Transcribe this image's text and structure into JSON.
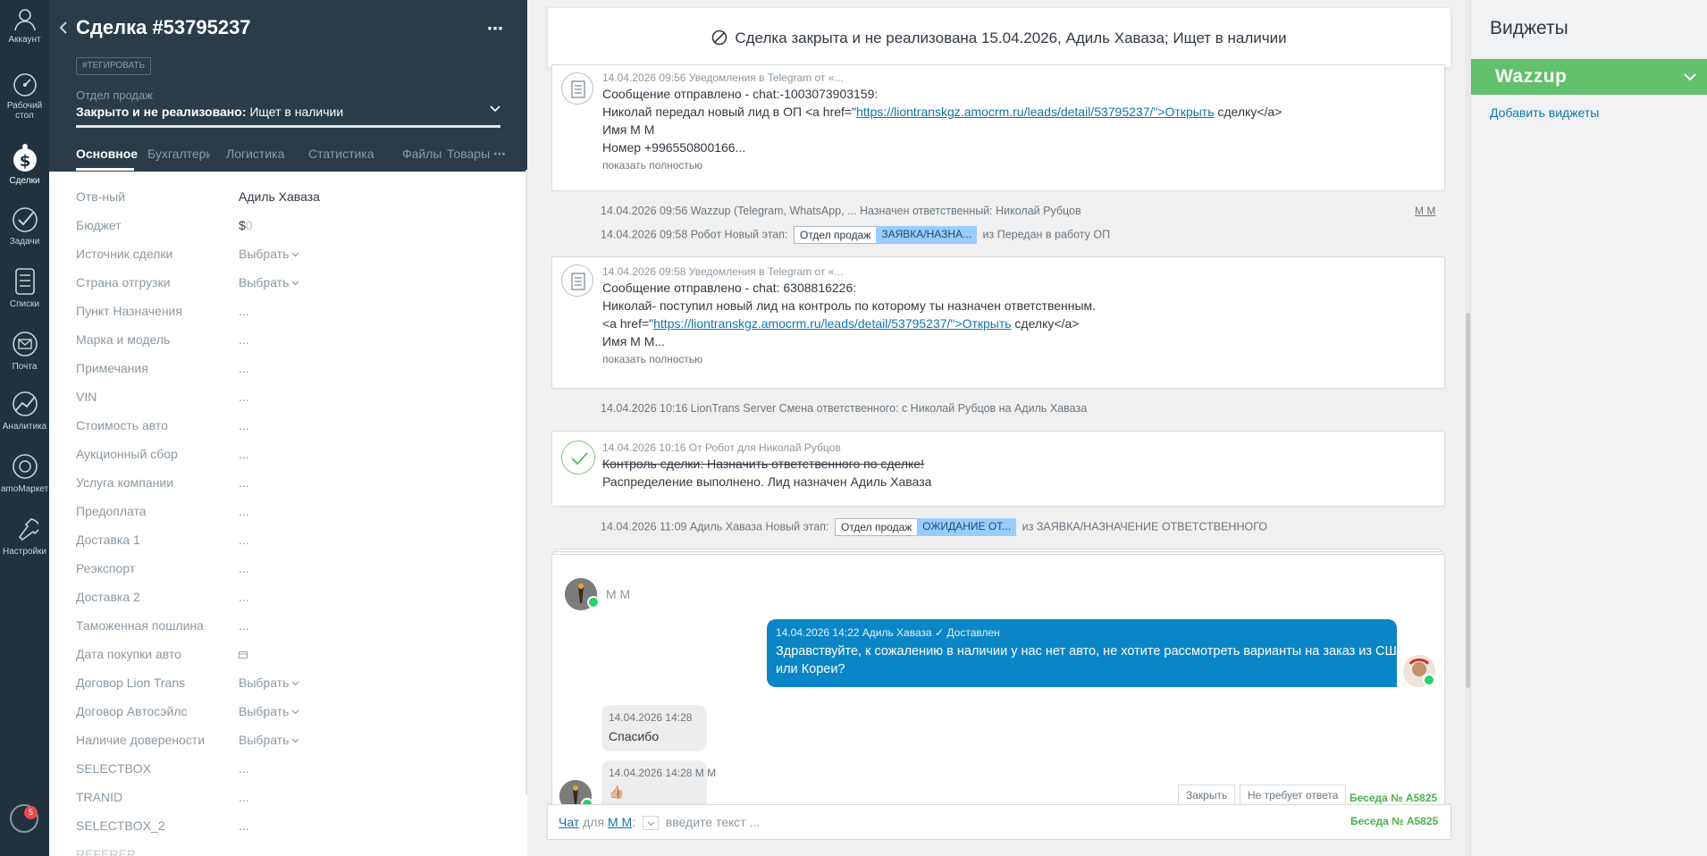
{
  "nav": {
    "items": [
      {
        "label": "Аккаунт",
        "icon": "account-icon"
      },
      {
        "label": "Рабочий стол",
        "icon": "dashboard-icon"
      },
      {
        "label": "Сделки",
        "icon": "deals-icon"
      },
      {
        "label": "Задачи",
        "icon": "tasks-icon"
      },
      {
        "label": "Списки",
        "icon": "lists-icon"
      },
      {
        "label": "Почта",
        "icon": "mail-icon"
      },
      {
        "label": "Аналитика",
        "icon": "analytics-icon"
      },
      {
        "label": "amoМаркет",
        "icon": "market-icon"
      },
      {
        "label": "Настройки",
        "icon": "settings-icon"
      }
    ],
    "notifications_count": "5"
  },
  "card": {
    "title": "Сделка #53795237",
    "tag_button": "#ТЕГИРОВАТЬ",
    "pipeline": "Отдел продаж",
    "status_bold": "Закрыто и не реализовано:",
    "status_rest": " Ищет в наличии",
    "tabs": [
      "Основное",
      "Бухгалтерия",
      "Логистика",
      "Статистика",
      "Файлы",
      "Товары"
    ],
    "fields": [
      {
        "label": "Отв-ный",
        "value": "Адиль Хаваза",
        "kind": "text"
      },
      {
        "label": "Бюджет",
        "value": "$",
        "zero": "0",
        "kind": "budget"
      },
      {
        "label": "Источник сделки",
        "value": "Выбрать",
        "kind": "select"
      },
      {
        "label": "Страна отгрузки",
        "value": "Выбрать",
        "kind": "select"
      },
      {
        "label": "Пункт Назначения",
        "value": "...",
        "kind": "dots"
      },
      {
        "label": "Марка и модель",
        "value": "...",
        "kind": "dots"
      },
      {
        "label": "Примечания",
        "value": "...",
        "kind": "dots"
      },
      {
        "label": "VIN",
        "value": "...",
        "kind": "dots"
      },
      {
        "label": "Стоимость авто",
        "value": "...",
        "kind": "dots"
      },
      {
        "label": "Аукционный сбор",
        "value": "...",
        "kind": "dots"
      },
      {
        "label": "Услуга компании",
        "value": "...",
        "kind": "dots"
      },
      {
        "label": "Предоплата",
        "value": "...",
        "kind": "dots"
      },
      {
        "label": "Доставка 1",
        "value": "...",
        "kind": "dots"
      },
      {
        "label": "Реэкспорт",
        "value": "...",
        "kind": "dots"
      },
      {
        "label": "Доставка 2",
        "value": "...",
        "kind": "dots"
      },
      {
        "label": "Таможенная пошлина",
        "value": "...",
        "kind": "dots"
      },
      {
        "label": "Дата покупки авто",
        "value": "",
        "kind": "date"
      },
      {
        "label": "Договор Lion Trans",
        "value": "Выбрать",
        "kind": "select"
      },
      {
        "label": "Договор Автосэйлс",
        "value": "Выбрать",
        "kind": "select"
      },
      {
        "label": "Наличие довереноcти",
        "value": "Выбрать",
        "kind": "select"
      },
      {
        "label": "SELECTBOX",
        "value": "...",
        "kind": "dots"
      },
      {
        "label": "TRANID",
        "value": "...",
        "kind": "dots"
      },
      {
        "label": "SELECTBOX_2",
        "value": "...",
        "kind": "dots"
      },
      {
        "label": "REFERER",
        "value": "",
        "kind": "text"
      }
    ]
  },
  "feed": {
    "banner": "Сделка закрыта и не реализована 15.04.2026, Адиль Хаваза; Ищет в наличии",
    "note1": {
      "meta": "14.04.2026 09:56 Уведомления в Telegram от «...",
      "line1": "Сообщение отправлено - chat:-1003073903159:",
      "line2_pre": "Николай передал новый лид в ОП <a href=\"",
      "line2_link": "https://liontranskgz.amocrm.ru/leads/detail/53795237/\">Открыть",
      "line2_post": " сделку</a>",
      "line3": "Имя М М",
      "line4": "Номер +996550800166...",
      "more": "показать полностью"
    },
    "event1": "14.04.2026 09:56 Wazzup (Telegram, WhatsApp, ... Назначен ответственный: Николай Рубцов",
    "event1_user": "М М",
    "event2_pre": "14.04.2026 09:58 Робот Новый этап:",
    "event2_chip1": "Отдел продаж",
    "event2_chip2": "ЗАЯВКА/НАЗНА...",
    "event2_post": "из Передан в работу ОП",
    "note2": {
      "meta": "14.04.2026 09:58 Уведомления в Telegram от «...",
      "line1": "Сообщение отправлено - chat: 6308816226:",
      "line2": "Николай- поступил новый лид на контроль по которому ты назначен ответственным.",
      "line3_pre": "<a href=\"",
      "line3_link": "https://liontranskgz.amocrm.ru/leads/detail/53795237/\">Открыть",
      "line3_post": " сделку</a>",
      "line4": "Имя М М...",
      "more": "показать полностью"
    },
    "event3": "14.04.2026 10:16 LionTrans Server Смена ответственного: с Николай Рубцов на Адиль Хаваза",
    "task": {
      "meta": "14.04.2026 10:16  От Робот для Николай Рубцов",
      "line1": "Контроль сделки: Назначить ответственного по сделке!",
      "line2": "Распределение выполнено. Лид назначен Адиль Хаваза"
    },
    "event4_pre": "14.04.2026 11:09 Адиль Хаваза Новый этап:",
    "event4_chip1": "Отдел продаж",
    "event4_chip2": "ОЖИДАНИЕ ОТ...",
    "event4_post": "из ЗАЯВКА/НАЗНАЧЕНИЕ ОТВЕТСТВЕННОГО",
    "chat": {
      "contact": "М М",
      "out_meta_time": "14.04.2026 14:22 Адиль Хаваза",
      "out_meta_status": "✓ Доставлен",
      "out_line1": "Здравствуйте, к сожалению в наличии у нас нет авто, не хотите рассмотреть варианты на заказ из США",
      "out_line2": "или Кореи?",
      "in1_meta": "14.04.2026 14:28",
      "in1_body": "Спасибо",
      "in2_meta": "14.04.2026 14:28 М М",
      "in2_body": "👍🏼",
      "btn_close": "Закрыть",
      "btn_no_reply": "Не требует ответа",
      "conv_num": "Беседа № А5825"
    },
    "composer": {
      "chat_link": "Чат",
      "for": "для",
      "recipient": "М М",
      "placeholder": "введите текст ...",
      "conv_num": "Беседа № А5825"
    }
  },
  "widgets": {
    "title": "Виджеты",
    "wazzup": "Wazzup",
    "add": "Добавить виджеты"
  }
}
